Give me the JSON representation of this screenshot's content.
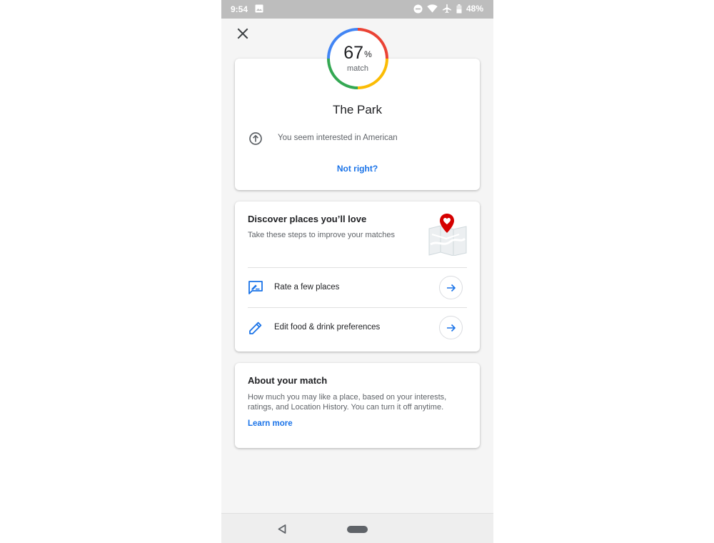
{
  "status_bar": {
    "time": "9:54",
    "battery": "48%",
    "icons": [
      "image-icon",
      "do-not-disturb-icon",
      "wifi-icon",
      "airplane-icon",
      "battery-icon"
    ]
  },
  "header": {
    "close_icon": "close-icon"
  },
  "match": {
    "value": "67",
    "unit": "%",
    "label": "match",
    "percent": 67
  },
  "place": {
    "name": "The Park",
    "interest_icon": "arrow-up-circle-icon",
    "interest_text": "You seem interested in American",
    "not_right": "Not right?"
  },
  "discover": {
    "title": "Discover places you’ll love",
    "subtitle": "Take these steps to improve your matches",
    "illustration": "map-with-heart-pin",
    "steps": [
      {
        "icon": "rate-review-icon",
        "label": "Rate a few places"
      },
      {
        "icon": "edit-pencil-icon",
        "label": "Edit food & drink preferences"
      }
    ]
  },
  "about": {
    "title": "About your match",
    "description": "How much you may like a place, based on your interests, ratings, and Location History. You can turn it off anytime.",
    "learn_more": "Learn more"
  },
  "colors": {
    "accent": "#1a73e8",
    "ring_red": "#ea4335",
    "ring_yellow": "#fbbc04",
    "ring_green": "#34a853",
    "ring_blue": "#4285f4"
  }
}
